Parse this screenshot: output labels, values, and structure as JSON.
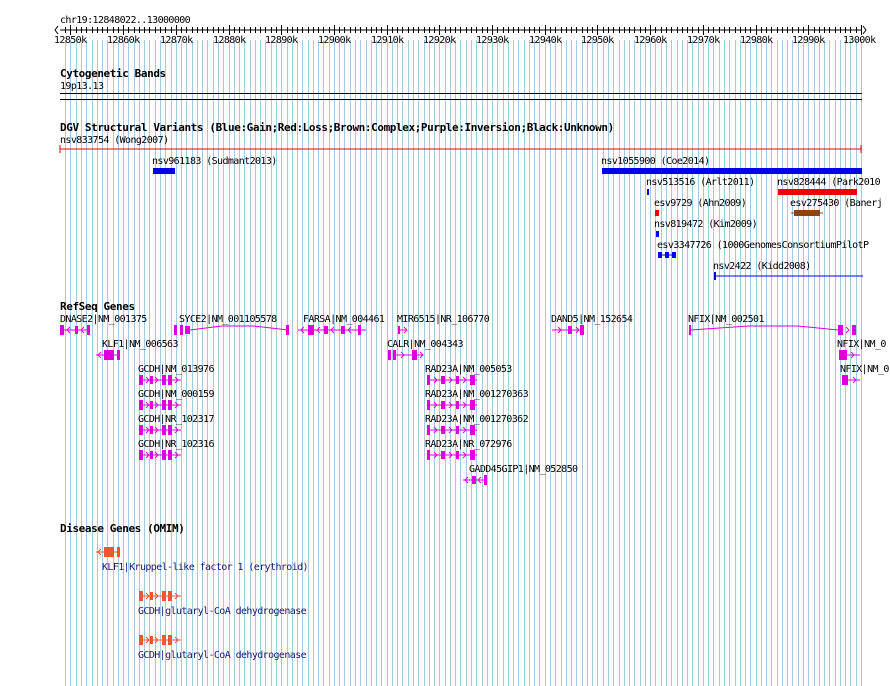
{
  "colors": {
    "grid": "#a8c8dc",
    "gain": "#0000ee",
    "loss": "#ee0000",
    "complex": "#8b4513",
    "gene": "#dd00dd",
    "disease": "#ee5533",
    "disease_text": "#1a1a6e"
  },
  "ruler": {
    "position": "chr19:12848022..13000000",
    "ticks": [
      "12850k",
      "12860k",
      "12870k",
      "12880k",
      "12890k",
      "12900k",
      "12910k",
      "12920k",
      "12930k",
      "12940k",
      "12950k",
      "12960k",
      "12970k",
      "12980k",
      "12990k",
      "13000k"
    ]
  },
  "cytoband": {
    "title": "Cytogenetic Bands",
    "band": "19p13.13"
  },
  "dgv": {
    "title": "DGV Structural Variants (Blue:Gain;Red:Loss;Brown:Complex;Purple:Inversion;Black:Unknown)",
    "items": [
      {
        "label": "nsv833754 (Wong2007)",
        "kind": "loss"
      },
      {
        "label": "nsv961183 (Sudmant2013)",
        "kind": "gain"
      },
      {
        "label": "nsv1055900 (Coe2014)",
        "kind": "gain"
      },
      {
        "label": "nsv513516 (Arlt2011)",
        "kind": "gain"
      },
      {
        "label": "nsv828444 (Park2010",
        "kind": "loss"
      },
      {
        "label": "esv9729 (Ahn2009)",
        "kind": "loss"
      },
      {
        "label": "esv275430 (Banerj",
        "kind": "complex"
      },
      {
        "label": "nsv819472 (Kim2009)",
        "kind": "gain"
      },
      {
        "label": "esv3347726 (1000GenomesConsortiumPilotP",
        "kind": "gain"
      },
      {
        "label": "nsv2422 (Kidd2008)",
        "kind": "gain"
      }
    ]
  },
  "refseq": {
    "title": "RefSeq Genes",
    "genes": [
      "DNASE2|NM_001375",
      "SYCE2|NM_001105578",
      "FARSA|NM_004461",
      "MIR6515|NR_106770",
      "DAND5|NM_152654",
      "NFIX|NM_002501",
      "KLF1|NM_006563",
      "CALR|NM_004343",
      "NFIX|NM_0",
      "GCDH|NM_013976",
      "RAD23A|NM_005053",
      "NFIX|NM_0",
      "GCDH|NM_000159",
      "RAD23A|NM_001270363",
      "GCDH|NR_102317",
      "RAD23A|NM_001270362",
      "GCDH|NR_102316",
      "RAD23A|NR_072976",
      "GADD45GIP1|NM_052850"
    ]
  },
  "omim": {
    "title": "Disease Genes (OMIM)",
    "genes": [
      "KLF1|Kruppel-like factor 1 (erythroid)",
      "GCDH|glutaryl-CoA dehydrogenase",
      "GCDH|glutaryl-CoA dehydrogenase"
    ]
  }
}
